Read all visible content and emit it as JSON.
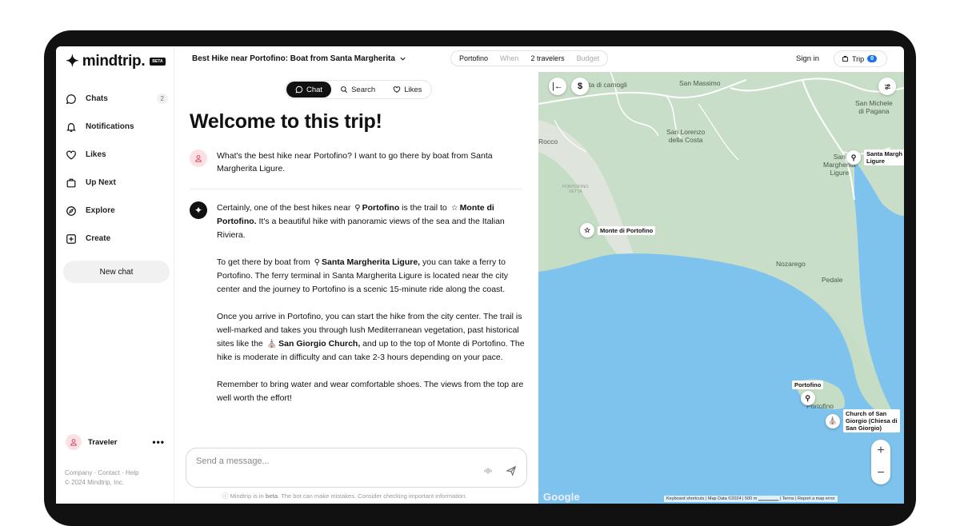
{
  "brand": {
    "logo_mark": "✦",
    "name": "mindtrip.",
    "badge": "BETA"
  },
  "sidebar": {
    "items": [
      {
        "label": "Chats",
        "icon": "chat-bubble-icon",
        "badge": "2"
      },
      {
        "label": "Notifications",
        "icon": "bell-icon"
      },
      {
        "label": "Likes",
        "icon": "heart-icon"
      },
      {
        "label": "Up Next",
        "icon": "suitcase-icon"
      },
      {
        "label": "Explore",
        "icon": "compass-icon"
      },
      {
        "label": "Create",
        "icon": "plus-square-icon"
      }
    ],
    "new_chat_label": "New chat",
    "user_name": "Traveler",
    "more_label": "•••",
    "footer_links": "Company · Contact · Help",
    "copyright": "© 2024 Mindtrip, Inc."
  },
  "topbar": {
    "trip_title": "Best Hike near Portofino: Boat from Santa Margherita",
    "trip_fields": {
      "destination": "Portofino",
      "when": "When",
      "travelers": "2 travelers",
      "budget": "Budget"
    },
    "sign_in": "Sign in",
    "trip_label": "Trip",
    "trip_count": "0"
  },
  "chat": {
    "tabs": [
      {
        "label": "Chat",
        "icon": "chat-bubble-icon",
        "active": true
      },
      {
        "label": "Search",
        "icon": "search-icon",
        "active": false
      },
      {
        "label": "Likes",
        "icon": "heart-icon",
        "active": false
      }
    ],
    "welcome": "Welcome to this trip!",
    "user_message": "What's the best hike near Portofino? I want to go there by boat from Santa Margherita Ligure.",
    "bot": {
      "p1_a": "Certainly, one of the best hikes near",
      "p1_place1": "Portofino",
      "p1_b": "is the trail to",
      "p1_place2": "Monte di Portofino.",
      "p1_c": "It's a beautiful hike with panoramic views of the sea and the Italian Riviera.",
      "p2_a": "To get there by boat from",
      "p2_place": "Santa Margherita Ligure,",
      "p2_b": "you can take a ferry to Portofino. The ferry terminal in Santa Margherita Ligure is located near the city center and the journey to Portofino is a scenic 15-minute ride along the coast.",
      "p3_a": "Once you arrive in Portofino, you can start the hike from the city center. The trail is well-marked and takes you through lush Mediterranean vegetation, past historical sites like the",
      "p3_place": "San Giorgio Church,",
      "p3_b": "and up to the top of Monte di Portofino. The hike is moderate in difficulty and can take 2-3 hours depending on your pace.",
      "p4": "Remember to bring water and wear comfortable shoes. The views from the top are well worth the effort!"
    },
    "input_placeholder": "Send a message...",
    "disclaimer_a": "ⓘ Mindtrip is in",
    "disclaimer_beta": "beta",
    "disclaimer_b": ". The bot can make mistakes. Consider checking important information."
  },
  "map": {
    "labels": {
      "camogli": "ta di camogli",
      "san_massimo": "San Massimo",
      "san_michele": "San Michele\ndi Pagana",
      "san_lorenzo": "San Lorenzo\ndella Costa",
      "rocco": "Rocco",
      "portofino_vetta": "PORTOFINO\nVETTA",
      "santa_margherita": "San\nMargherita\nLigure",
      "nozarego": "Nozarego",
      "pedale": "Pedale",
      "portofino_town": "Portofino"
    },
    "pins": {
      "monte": "Monte di Portofino",
      "santa_marg": "Santa Margh\nLigure",
      "portofino": "Portofino",
      "church": "Church of San\nGiorgio (Chiesa di\nSan Giorgio)"
    },
    "collapse_icon": "|←",
    "price_icon": "$",
    "zoom_in": "+",
    "zoom_out": "−",
    "google": "Google",
    "attribution": "Keyboard shortcuts  |  Map Data ©2024  |  500 m ▁▁▁▁▁▁  |  Terms  |  Report a map error",
    "colors": {
      "land": "#dfe5dc",
      "forest": "#c6ddc5",
      "sea": "#7ec3ee",
      "road": "#ffffff"
    }
  }
}
